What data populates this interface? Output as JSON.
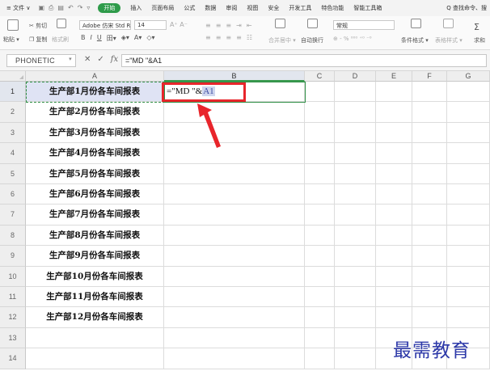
{
  "menubar": {
    "file_label": "≡ 文件 ∨",
    "start_label": "开始",
    "items": [
      "插入",
      "页面布局",
      "公式",
      "数据",
      "审阅",
      "视图",
      "安全",
      "开发工具",
      "特色功能",
      "智能工具箱"
    ],
    "search_label": "Q 查找命令、搜"
  },
  "ribbon": {
    "paste_label": "粘贴 ▾",
    "cut_label": "✂ 剪切",
    "copy_label": "复制",
    "format_painter_label": "格式刷",
    "font_name": "Adobe 仿宋 Std R",
    "font_size": "14",
    "merge_label": "合并居中 ▾",
    "wrap_label": "自动换行",
    "number_format": "常规",
    "cond_format_label": "条件格式 ▾",
    "table_style_label": "表格样式 ▾",
    "sum_label": "求和"
  },
  "formula_bar": {
    "name_box": "PHONETIC",
    "fx_label": "fx",
    "formula": "=\"MD \"&A1"
  },
  "columns": [
    "A",
    "B",
    "C",
    "D",
    "E",
    "F",
    "G"
  ],
  "rows": [
    "1",
    "2",
    "3",
    "4",
    "5",
    "6",
    "7",
    "8",
    "9",
    "10",
    "11",
    "12",
    "13",
    "14"
  ],
  "column_a": [
    "生产部1月份各车间报表",
    "生产部2月份各车间报表",
    "生产部3月份各车间报表",
    "生产部4月份各车间报表",
    "生产部5月份各车间报表",
    "生产部6月份各车间报表",
    "生产部7月份各车间报表",
    "生产部8月份各车间报表",
    "生产部9月份各车间报表",
    "生产部10月份各车间报表",
    "生产部11月份各车间报表",
    "生产部12月份各车间报表",
    "",
    ""
  ],
  "edit_cell": {
    "prefix": "=\"MD \"&",
    "ref": "A1"
  },
  "watermark": "最需教育",
  "colors": {
    "accent_green": "#2e9b4a",
    "highlight_red": "#e8252b",
    "selection_blue": "#dfe3f4",
    "watermark_blue": "#2c38a8"
  }
}
